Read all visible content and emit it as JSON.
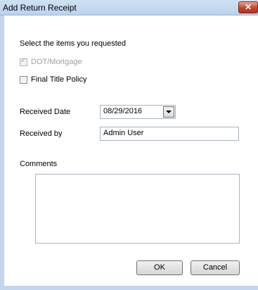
{
  "window": {
    "title": "Add Return Receipt",
    "close_icon": "close-x-icon"
  },
  "form": {
    "instruction": "Select the items you requested",
    "items": [
      {
        "label": "DOT/Mortgage",
        "checked": true,
        "enabled": false
      },
      {
        "label": "Final Title Policy",
        "checked": false,
        "enabled": true
      }
    ],
    "received_date": {
      "label": "Received Date",
      "value": "08/29/2016"
    },
    "received_by": {
      "label": "Received by",
      "value": "Admin User"
    },
    "comments": {
      "label": "Comments",
      "value": ""
    }
  },
  "buttons": {
    "ok": "OK",
    "cancel": "Cancel"
  }
}
